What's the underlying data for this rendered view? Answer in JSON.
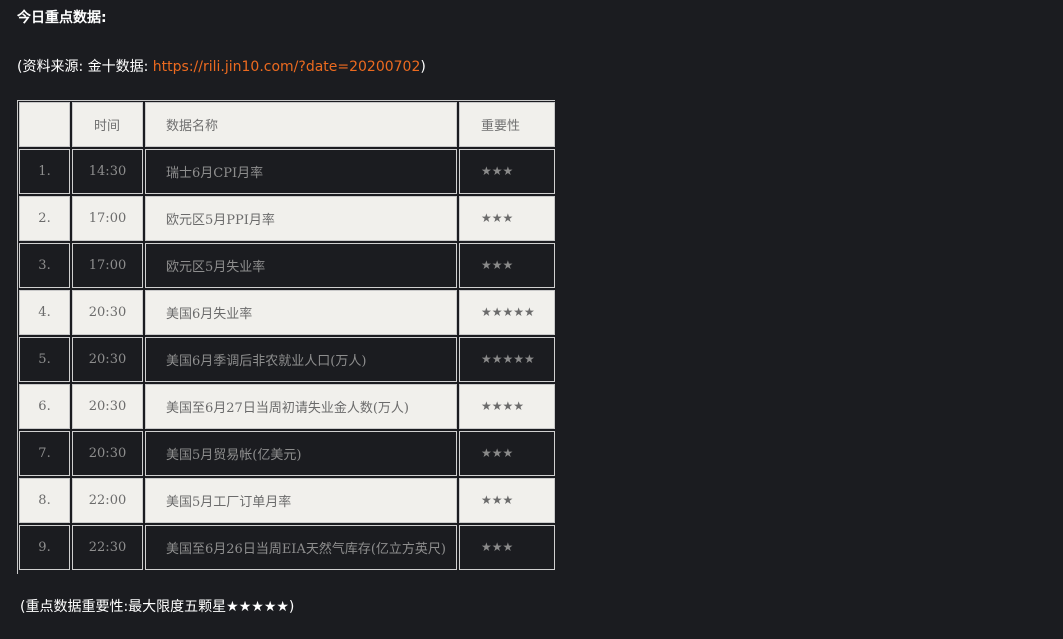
{
  "heading": "今日重点数据:",
  "source": {
    "prefix": "(资料来源: 金十数据: ",
    "url_text": "https://rili.jin10.com/?date=20200702",
    "suffix": ")"
  },
  "table": {
    "headers": [
      "",
      "时间",
      "数据名称",
      "重要性"
    ],
    "rows": [
      {
        "idx": "1.",
        "time": "14:30",
        "name": "瑞士6月CPI月率",
        "importance": "★★★"
      },
      {
        "idx": "2.",
        "time": "17:00",
        "name": "欧元区5月PPI月率",
        "importance": "★★★"
      },
      {
        "idx": "3.",
        "time": "17:00",
        "name": "欧元区5月失业率",
        "importance": "★★★"
      },
      {
        "idx": "4.",
        "time": "20:30",
        "name": "美国6月失业率",
        "importance": "★★★★★"
      },
      {
        "idx": "5.",
        "time": "20:30",
        "name": "美国6月季调后非农就业人口(万人)",
        "importance": "★★★★★"
      },
      {
        "idx": "6.",
        "time": "20:30",
        "name": "美国至6月27日当周初请失业金人数(万人)",
        "importance": "★★★★"
      },
      {
        "idx": "7.",
        "time": "20:30",
        "name": "美国5月贸易帐(亿美元)",
        "importance": "★★★"
      },
      {
        "idx": "8.",
        "time": "22:00",
        "name": "美国5月工厂订单月率",
        "importance": "★★★"
      },
      {
        "idx": "9.",
        "time": "22:30",
        "name": "美国至6月26日当周EIA天然气库存(亿立方英尺)",
        "importance": "★★★"
      }
    ]
  },
  "footnote": "(重点数据重要性:最大限度五颗星★★★★★)",
  "colors": {
    "background": "#1b1c20",
    "link": "#ec6a1f",
    "light_row": "#f1f0ec"
  }
}
